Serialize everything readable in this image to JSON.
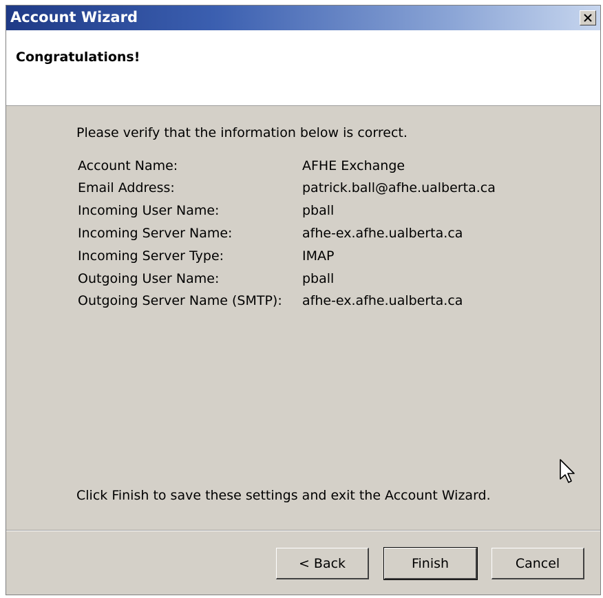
{
  "window": {
    "title": "Account Wizard",
    "close_glyph": "✕"
  },
  "header": {
    "title": "Congratulations!"
  },
  "content": {
    "intro": "Please verify that the information below is correct.",
    "rows": [
      {
        "label": "Account Name:",
        "value": "AFHE Exchange"
      },
      {
        "label": "Email Address:",
        "value": "patrick.ball@afhe.ualberta.ca"
      },
      {
        "label": "Incoming User Name:",
        "value": "pball"
      },
      {
        "label": "Incoming Server Name:",
        "value": "afhe-ex.afhe.ualberta.ca"
      },
      {
        "label": "Incoming Server Type:",
        "value": "IMAP"
      },
      {
        "label": "Outgoing User Name:",
        "value": "pball"
      },
      {
        "label": "Outgoing Server Name (SMTP):",
        "value": "afhe-ex.afhe.ualberta.ca"
      }
    ],
    "footer": "Click Finish to save these settings and exit the Account Wizard."
  },
  "buttons": {
    "back": "< Back",
    "finish": "Finish",
    "cancel": "Cancel"
  },
  "colors": {
    "titlebar_start": "#1f3a86",
    "titlebar_end": "#c7d6ee",
    "dialog_face": "#d4d0c8"
  },
  "icons": {
    "close": "close-icon",
    "cursor": "mouse-pointer-icon"
  }
}
